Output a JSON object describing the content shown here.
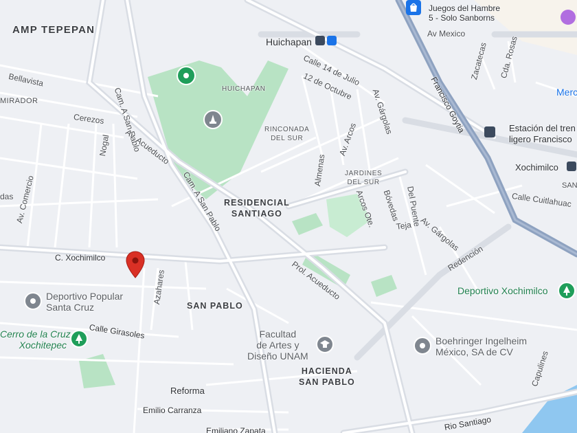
{
  "map": {
    "areas": {
      "amp_tepepan": "AMP TEPEPAN",
      "huichapan_area": "HUICHAPAN",
      "rinconada_del_sur": [
        "RINCONADA",
        "DEL SUR"
      ],
      "jardines_del_sur": [
        "JARDINES",
        "DEL SUR"
      ],
      "residencial_santiago": [
        "RESIDENCIAL",
        "SANTIAGO"
      ],
      "san_pablo": "SAN PABLO",
      "hacienda_san_pablo": [
        "HACIENDA",
        "SAN PABLO"
      ]
    },
    "streets": {
      "cam_a_san_pablo_1": "Cam. A San Pablo",
      "cam_a_san_pablo_2": "Cam. A San Pablo",
      "av_acueducto": "Av. Acueducto",
      "prol_acueducto": "Prol. Acueducto",
      "calle_14_de_julio": "Calle 14 de Julio",
      "doce_de_octubre": "12 de Octubre",
      "av_arcos": "Av. Arcos",
      "av_gargolas_1": "Av. Gárgolas",
      "av_gargolas_2": "Av. Gárgolas",
      "francisco_goytia": "Francisco Goytia",
      "av_mexico": "Av Mexico",
      "zacatecas": "Zacatecas",
      "cda_rosas": "Cda. Rosas",
      "calle_cuitlahuac": "Calle Cuitlahuac",
      "redencion": "Redención",
      "almenas": "Almenas",
      "arcos_ote": "Arcos Ote.",
      "bovedas": "Bóvedas",
      "del_puente": "Del Puente",
      "teja": "Teja",
      "bellavista": "Bellavista",
      "mirador": "MIRADOR",
      "cerezos": "Cerezos",
      "nogal": "Nogal",
      "av_comercio": "Av. Comercio",
      "das": "das",
      "c_xochimilco": "C. Xochimilco",
      "azahares": "Azahares",
      "calle_girasoles": "Calle Girasoles",
      "reforma": "Reforma",
      "emilio_carranza": "Emilio Carranza",
      "emiliano_zapata": "Emiliano Zapata",
      "rio_santiago": "Rio Santiago",
      "capulines": "Capulines",
      "san_right": "SAN",
      "merc": "Merc"
    },
    "pois": {
      "juegos_del_hambre": [
        "Juegos del Hambre",
        "5 - Solo Sanborns"
      ],
      "huichapan_station": "Huichapan",
      "estacion_tren": [
        "Estación del tren",
        "ligero Francisco"
      ],
      "xochimilco_station": "Xochimilco",
      "deportivo_xochimilco": "Deportivo Xochimilco",
      "boehringer": [
        "Boehringer Ingelheim",
        "México, SA de CV"
      ],
      "facultad": [
        "Facultad",
        "de Artes y",
        "Diseño UNAM"
      ],
      "deportivo_popular": [
        "Deportivo Popular",
        "Santa Cruz"
      ],
      "cerro_de_la_cruz": [
        "Cerro de la Cruz",
        "Xochitepec"
      ]
    },
    "colors": {
      "background": "#eef0f4",
      "road": "#ffffff",
      "major_road": "#d9dde4",
      "highway": "#8ea2c0",
      "park": "#b8e3c4",
      "water": "#8fc7f0",
      "pin": "#d93025",
      "park_text": "#1f7f4e",
      "blue_text": "#1a73e8"
    }
  }
}
